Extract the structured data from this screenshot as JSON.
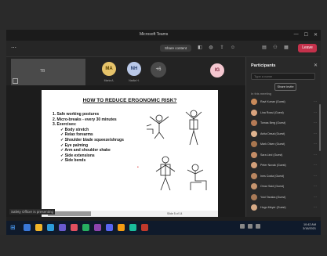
{
  "window": {
    "title": "Microsoft Teams"
  },
  "toolbar": {
    "menu_icon": "more-options-icon",
    "timer": "Share content",
    "leave_label": "Leave",
    "icons": [
      "camera-icon",
      "mic-icon",
      "share-icon",
      "reactions-icon",
      "chat-icon",
      "participants-icon",
      "view-icon"
    ]
  },
  "video": {
    "tile_label": "TB",
    "avatars": [
      {
        "initials": "MA",
        "bg": "#e6c36a",
        "fg": "#5a4200",
        "label": "Maria A."
      },
      {
        "initials": "NH",
        "bg": "#b9c8e8",
        "fg": "#263d6b",
        "label": "Nadia H."
      },
      {
        "initials": "IG",
        "bg": "#f4c7d0",
        "fg": "#7a1f36",
        "label": ""
      }
    ],
    "more_label": "+6"
  },
  "slide": {
    "title": "HOW TO REDUCE ERGONOMIC RISK?",
    "items": [
      {
        "text": "1.  Safe working postures",
        "sub": false
      },
      {
        "text": "2.  Micro-breaks - every 30 minutes",
        "sub": false
      },
      {
        "text": "3.  Exercises:",
        "sub": false
      },
      {
        "text": "✓  Body stretch",
        "sub": true
      },
      {
        "text": "✓  Relax forearms",
        "sub": true
      },
      {
        "text": "✓  Shoulder blade squeeze/shrugs",
        "sub": true
      },
      {
        "text": "✓  Eye palming",
        "sub": true
      },
      {
        "text": "✓  Arm and shoulder shake",
        "sub": true
      },
      {
        "text": "✓  Side extensions",
        "sub": true
      },
      {
        "text": "✓  Side bends",
        "sub": true
      }
    ],
    "page_indicator": "Slide 5 of 14",
    "presenter": "Safety Officer is presenting"
  },
  "panel": {
    "title": "Participants",
    "search_placeholder": "Type a name",
    "share_label": "Share invite",
    "section": "In this meeting",
    "participants": [
      {
        "name": "Ravi Kumar (Guest)",
        "color": "#c98a5a"
      },
      {
        "name": "Lina Rossi (Guest)",
        "color": "#d9a37e"
      },
      {
        "name": "Tomas Berg (Guest)",
        "color": "#b57a55"
      },
      {
        "name": "Anita Desai (Guest)",
        "color": "#e0b48f"
      },
      {
        "name": "Mark Olsen (Guest)",
        "color": "#a8764f"
      },
      {
        "name": "Sara Lind (Guest)",
        "color": "#c58d66"
      },
      {
        "name": "Peter Novak (Guest)",
        "color": "#d3a07a"
      },
      {
        "name": "Ines Costa (Guest)",
        "color": "#b98660"
      },
      {
        "name": "Omar Said (Guest)",
        "color": "#c5946e"
      },
      {
        "name": "Yuki Tanaka (Guest)",
        "color": "#a97a57"
      },
      {
        "name": "Hugo Meyer (Guest)",
        "color": "#d8ab86"
      }
    ]
  },
  "taskbar": {
    "clock_time": "10:42 AM",
    "clock_date": "3/18/2021",
    "apps": [
      "#3a78d8",
      "#f0b429",
      "#2d9cdb",
      "#6a5acd",
      "#e04f5f",
      "#27ae60",
      "#8e44ad",
      "#5865f2",
      "#f39c12",
      "#1abc9c",
      "#c0392b"
    ]
  }
}
